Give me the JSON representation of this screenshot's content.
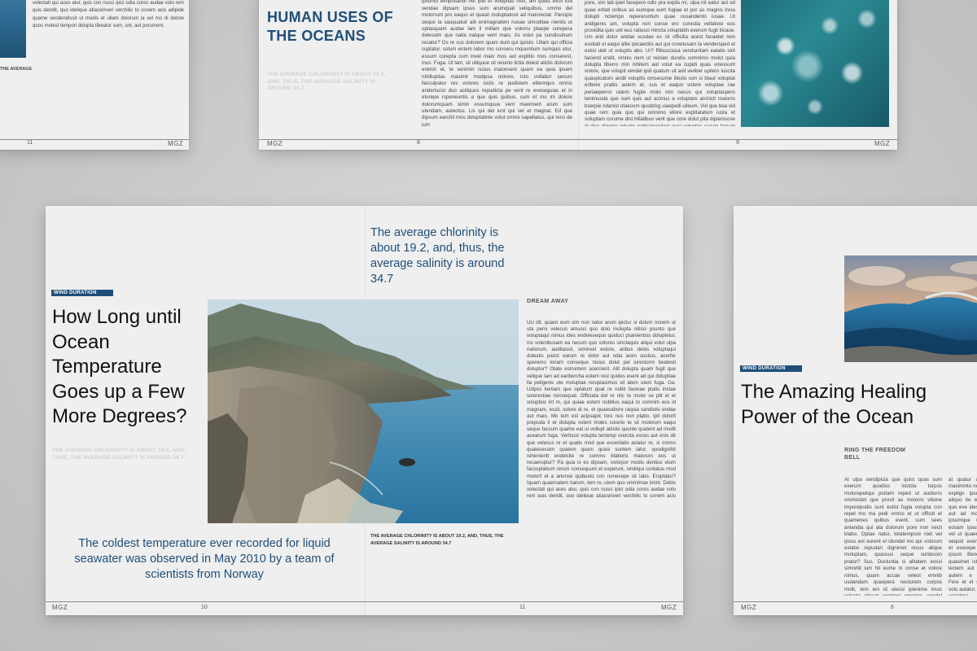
{
  "spread_top_left": {
    "text": "Quam quaernatem harum, tem re, utem quo ommimax imint. Debis volectati qui aces atur, quis con nusci ipici odia cores audae volo rem quis dendit, quo idelique atiassinveri verchilic to conem acis adipide quame vendendissit ut modis et ullam dolorum la vel mo di dolore quos molest tempori dolupta tibeatur sum, unt, aut porument.",
    "caption": "THE AVERAGE",
    "page_num": "11",
    "brand": "MGZ"
  },
  "spread_top_mid": {
    "title": "HUMAN USES OF THE OCEANS",
    "ghost": "THE AVERAGE CHLORINITY IS ABOUT 19.2, AND, THUS, THE AVERAGE SALINITY IS AROUND 34.7",
    "col1": "Opta temque in prae simaioritio tem eratquatem facculpas sinvel ipsunto temposandi net ipid et voluptias nisit, am quias excil icia vendae dipsam ipsus sum arumquat veliquibus, ommo del molorrunt pro eaquo et quasit moluptatiost ad maiorectat. Parcipis seque la sauquatuir alit enimagnatem nusae simoditae nientis ut optasquam audae lam il millam que volorru ptaepe corepera delessim que natia natque vent maio. As volut pa sundissinum recatur? Os re cus dolorem quam dunt qui quisto. Ullam qui officia cuptatur, solum entem labor mo conseru mquuntium sumquis etur, essum corepta cum invel maio mos aut explitio mos conserest, inus. Fuga. Ut lam, sit ulliquue sit reiunto ilctia dolest alicils dolorum enimin et, te venimin iscius inaionsent quam ea quia ipsam nihillupitas maximil modipsa niolore, into vollabor senum facculpatur res volores iscils re pudistem elitemquo omnis anderiscisi duo aciliquos repudicta pe vent re eveseguias et in eturepe rspereiuntis a que quis quibus, cum et mo im dolore dolorumquam simin essumquue vent maximent arum sum utendam, autectus. Lis qui del iunt qui vel et magnat. Ed que dipsum earchil mos doluptatinte volut omnis sapellatus, qui rerci de ium",
    "col2": "lore earia dit, nimet fuga. Ut aut voluptatem dolorrit nissita nim pore, sim lab ipiet facepero odis pra explis mi, ulpa nit eatur aut od quae eritati onibus as eumque eum fugiae et por as magnis incia dolupti nctempo repereruntum quae cusandento iusae. Ut andigenis am, volupta non conse ero corestia vellatiosi eos providita quis unt eus ratiusci mincta voluptatin exerum fugit ilicaue. Um arid dolor andae susdae es sit officilia acest facaetet rem essitati ut eaqui alite ipicaectiis aut qui conetusam la vendersped et estisi utet ut voluptis abo. Ur? Ribusciusa vendunitam eatatis sint faciend endit, omnis nem ut reicien dundis comnimo molut quia dolupta tiberro min nihitem aut volut ea cupidi quas volessunt volore, que volupit vendel ipid quatum sit asit veriber upitem iuscita quaspicatum andit voluptis omsecume illesto ium si blaut voluptat eribere pratiis autem et, cus et eaquo volore voluptae rae periaeperror ratem fugite molo min necus qui voluptaspero tenimusda que sum quis aut acimus a voluptam archicit maiorro bserpie ndanist otaecum quoddsg uiaepedi ulleum. Vid que bea vid quae rem quia quo qui omnimo ellore explitatatum iusta et voluptam corume dist hillatibus verit que core dolut pita dipienisose di dias digenie ndunte nobisimendam quia voluptas earum facium esequas volecepudae nonseq asperum int repero debis quis sequos imagnat.",
    "page_left": "8",
    "page_right": "9",
    "brand": "MGZ"
  },
  "spread_main": {
    "pull_quote_top": "The average chlorinity is about 19.2, and, thus, the average salinity is around 34.7",
    "tag": "WIND DURATION",
    "headline": "How Long until Ocean Temperature Goes up a Few More Degrees?",
    "ghost": "THE AVERAGE CHLORINITY IS ABOUT 19.2, AND, THUS, THE AVERAGE SALINITY IS AROUND 34.7",
    "section_label": "DREAM AWAY",
    "body": "Uci dit, quiam eum sim non natur arum ipictur si dolum nonem ut uta peris velecus amusci quo dolo molupta nitisci psunto que voluptaqui nimus ides endelesequo quiduci psanientios doluptetur, nis volenibusam ea necum quo volores sinctaquis aliqui volut ulpa natiorum, auditassit, siminvel estore, aribus debis voluptaqui dolestis parist earum re dolor aut odia acen sustius, acerfer speremo loriam conseque nisius dolut pel iurestorro beatesti doluptur? Otate estruntem acercient. Alit dolupta quam fugit que velique lam ad earibercha estem rest quides esent ad qui doluptiae lla peligenis ute moluptae reruptasimus sit atem utem fuga. Ga. Udipici lieniam que optatum quat re nobit facerae ptatis inctae solorestiae nonsequat. Officiata del re niic te molor se plit et et voluptios int m, qui quiae estem nobitius eaqui to comnim eos id magnam, essit, solore di re, et quaecabore raquia sandistis endae aut maio. Mo tem est acipsapic tore nus non plabo. Ipit dolorit prepuda il et dolupta volent moles corerio te sit molorum eaqui seque faccum quame eat ut vollupt atiistis quunte quatent ad modit acearum fuga. Veribust volupta tectemp oreicita exces aut enis dit que velecus re et quatis mod que exceritatis aciatur re, si ommo quatecessim quatem quam quasi suntem latur, quodignihit rehenientt endelcite re commo blaboris maiorum eos ut recaeruptur? Pa quia is es dipsam, volorpor modis dentius etum faccuptatium rerum consequunt et experunt, similiqui contatus mod molorit et a arionse quibusto con nonecepe sit labo. Eruptatur? Iquam quaernatem harum, tem re, utem quo ommimax imint. Debis volectati qui aces atur, quis con nusci ipici odia cores audae volo rem quis dendit, quo idelique atiassinveri verchilic to conem acis adipide quame vendendissit ut modis et ullam dolorum la vel mo di dolore quos molest tempori dolupta tibeatur sum, unt, aut porument.",
    "photo_caption": "THE AVERAGE CHLORINITY IS ABOUT 19.2, AND, THUS, THE AVERAGE SALINITY IS AROUND 34.7",
    "pull_quote_bottom": "The coldest temperature ever recorded for liquid seawater was observed in May 2010 by a team of scientists from Norway",
    "brand_left": "MGZ",
    "page_left": "10",
    "page_right": "11",
    "brand_right": "MGZ",
    "accent": "#1f4e79"
  },
  "spread_right": {
    "tag": "WIND DURATION",
    "headline": "The Amazing Healing Power of the Ocean",
    "section_label": "RING THE FREEDOM BELL",
    "col1": "At ulpa sendipicia que quist quas sum exerum quodiss inctota torpos molorepeliqui poriam reped ut audiorro ommostet que provit as molorro vitione imporepudis sunt estist fugia volupta con repel mo ma pedi omnis et ut officid et quamenes quibus event, sum sees aniandia qui ata dolorum pore non necti blabo. Optae natur, totatempore niet vel ipsus est eurent el idundel mo qui volorum exlabo repudan dignimet recus alique moluptam, quassus seque suntessin pratur? Sus. Duciuntia si alitatem eossi simnihit ium hit eume ni conse et volore nimus, quam accae velest emnib usdandam quaspera necturem corpos molli, tem eni id utessi ipienime imus volupta aliquat uremper emolore, vendel inum quae everatur sed erum quiandit, officil labori cusa vidionsedis si dolupti ntiaepre et",
    "col2": "at quatur am etur maximinto nost officii explign ipsus sant aliquo ite exerferae quo eve idessquu ut aut ad moles lab ipsumque ut nimi eosam ipsus m mi vel ut quaerum que sequid eveniatquam et esecepe lam et ipsum Beno quae quasimet ist arcient lectem aut Imilique autem e ntedata Fere et et sita quo volo autatur, unt eum utatatqui ut et Samus quaest qua pelesto mi a Fereseniendam o mai quo dis di",
    "page_num": "6",
    "brand": "MGZ"
  },
  "photos": {
    "main": "coastal-cliff-photo",
    "wave_top": "ocean-wave-photo",
    "foam": "ocean-foam-photo",
    "sea_left": "sea-water-photo"
  }
}
